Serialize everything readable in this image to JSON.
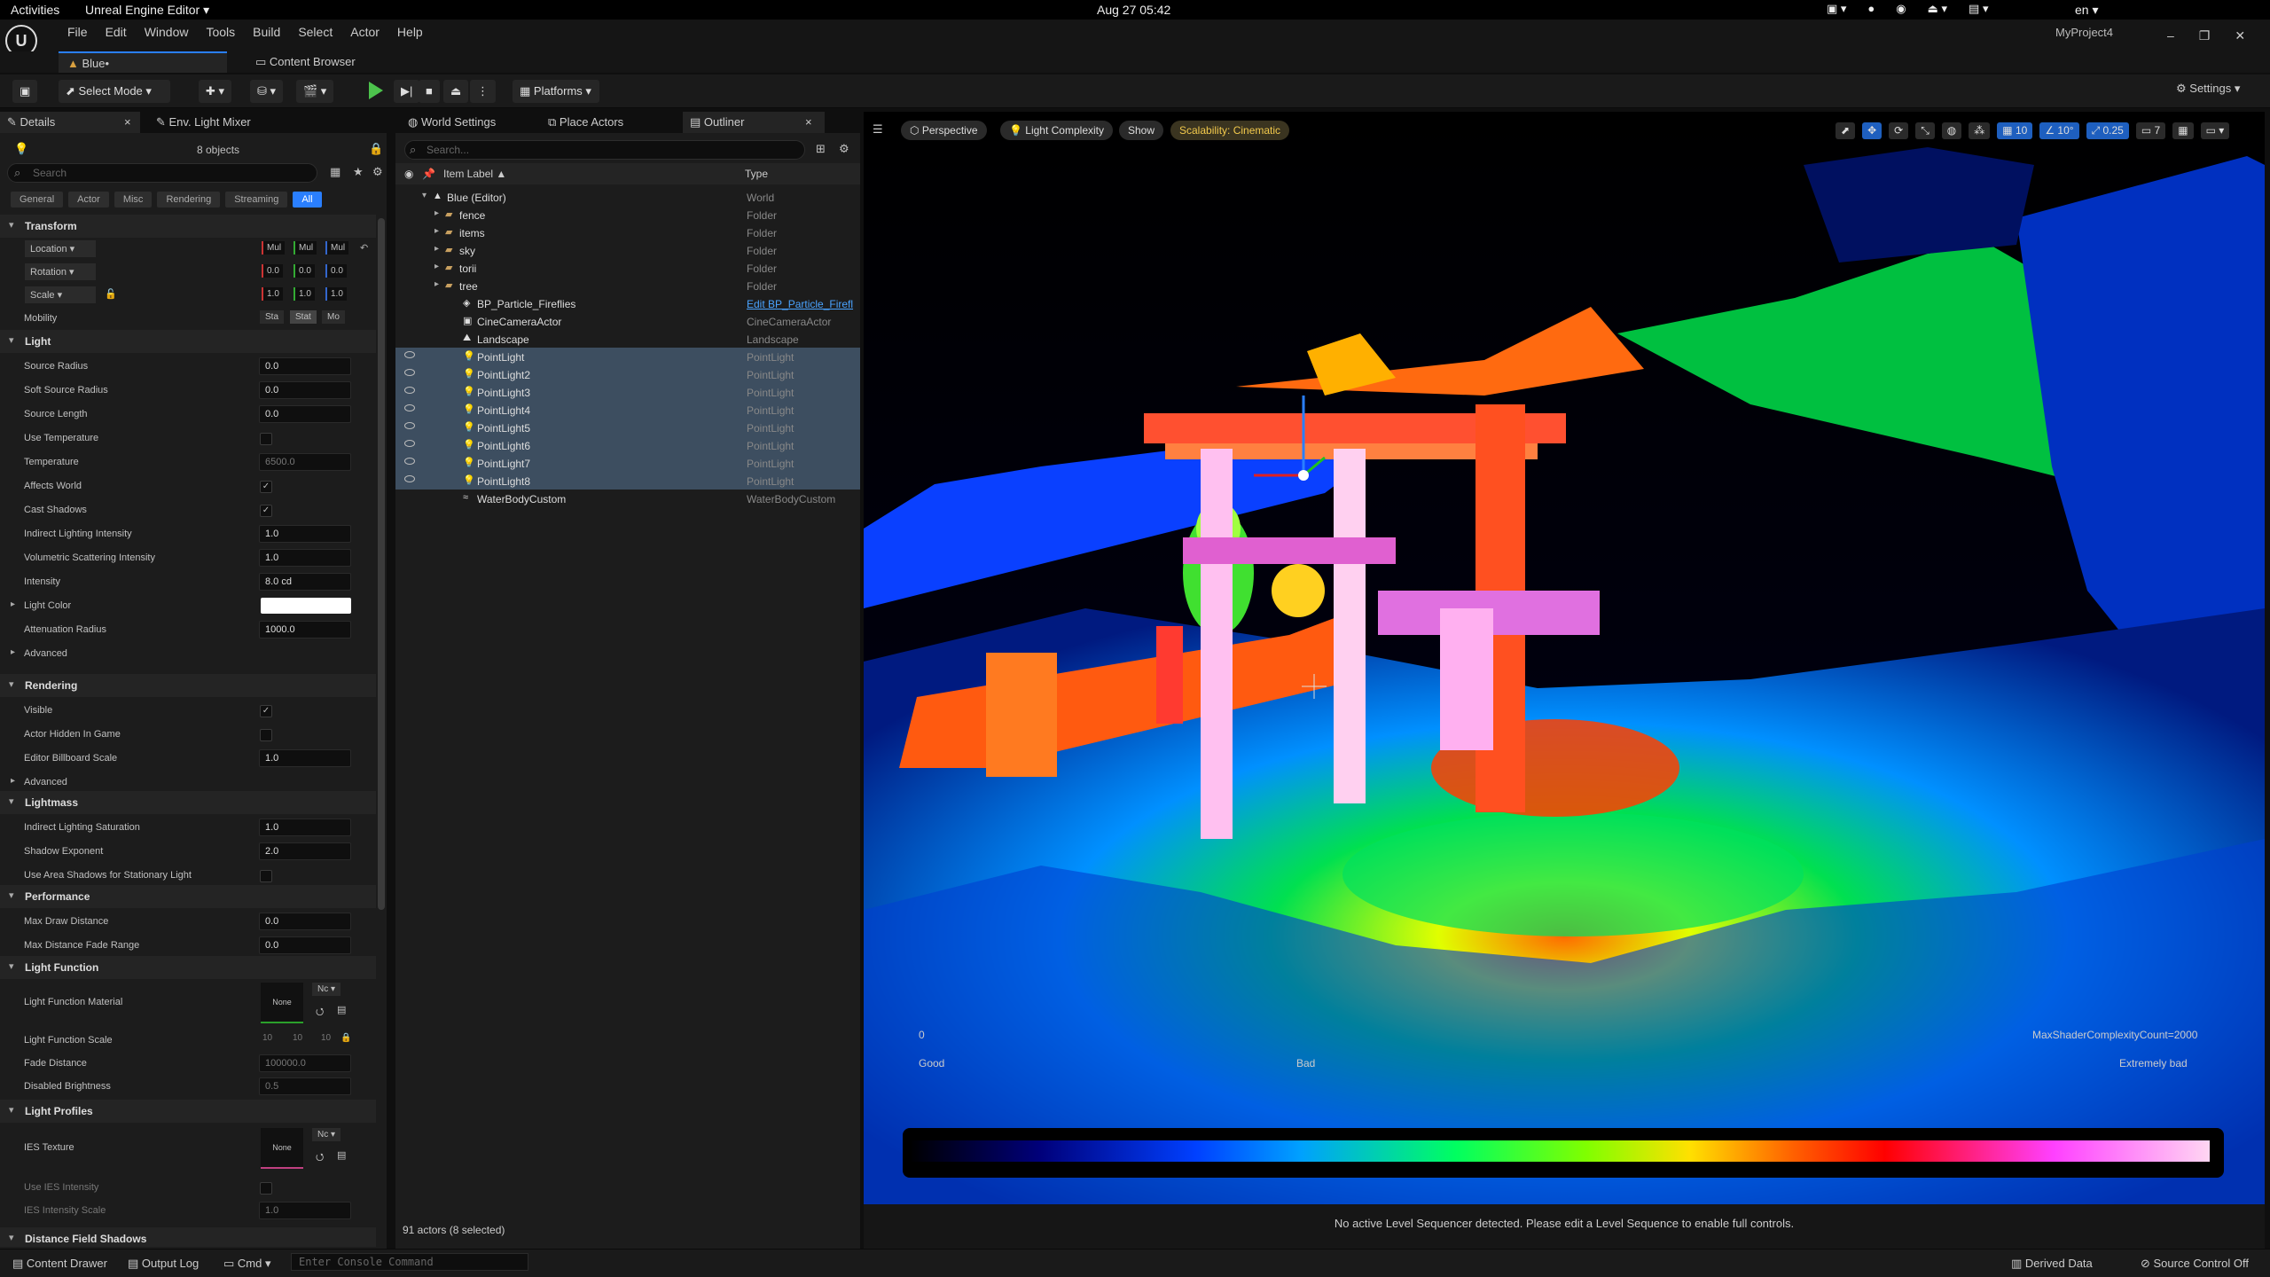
{
  "gnome": {
    "activities": "Activities",
    "app": "Unreal Engine Editor ▾",
    "clock": "Aug 27  05:42",
    "lang": "en ▾"
  },
  "menu": [
    "File",
    "Edit",
    "Window",
    "Tools",
    "Build",
    "Select",
    "Actor",
    "Help"
  ],
  "project": "MyProject4",
  "tabs": {
    "level": "Blue•",
    "content_browser": "Content Browser"
  },
  "toolbar": {
    "mode": "Select Mode",
    "platforms": "Platforms",
    "settings": "Settings"
  },
  "panel_tabs": {
    "details": "Details",
    "env_light": "Env. Light Mixer",
    "world_settings": "World Settings",
    "place_actors": "Place Actors",
    "outliner": "Outliner"
  },
  "details": {
    "count": "8 objects",
    "search_placeholder": "Search",
    "filters": [
      "General",
      "Actor",
      "Misc",
      "Rendering",
      "Streaming",
      "All"
    ],
    "sections": {
      "transform": "Transform",
      "light": "Light",
      "rendering": "Rendering",
      "lightmass": "Lightmass",
      "performance": "Performance",
      "light_function": "Light Function",
      "light_profiles": "Light Profiles",
      "dfs": "Distance Field Shadows"
    },
    "transform": {
      "location": "Location",
      "rotation": "Rotation",
      "scale": "Scale",
      "mobility": "Mobility",
      "loc_vals": [
        "Mul",
        "Mul",
        "Mul"
      ],
      "rot_vals": [
        "0.0",
        "0.0",
        "0.0"
      ],
      "scale_vals": [
        "1.0",
        "1.0",
        "1.0"
      ],
      "mobility_opts": [
        "Sta",
        "Stat",
        "Mo"
      ]
    },
    "light_props": [
      {
        "label": "Source Radius",
        "value": "0.0"
      },
      {
        "label": "Soft Source Radius",
        "value": "0.0"
      },
      {
        "label": "Source Length",
        "value": "0.0"
      },
      {
        "label": "Use Temperature",
        "value": ""
      },
      {
        "label": "Temperature",
        "value": "6500.0"
      },
      {
        "label": "Affects World",
        "value": "✓"
      },
      {
        "label": "Cast Shadows",
        "value": "✓"
      },
      {
        "label": "Indirect Lighting Intensity",
        "value": "1.0"
      },
      {
        "label": "Volumetric Scattering Intensity",
        "value": "1.0"
      },
      {
        "label": "Intensity",
        "value": "8.0 cd"
      },
      {
        "label": "Light Color",
        "value": ""
      },
      {
        "label": "Attenuation Radius",
        "value": "1000.0"
      },
      {
        "label": "Advanced",
        "value": ""
      }
    ],
    "rendering_props": [
      {
        "label": "Visible",
        "value": "✓"
      },
      {
        "label": "Actor Hidden In Game",
        "value": ""
      },
      {
        "label": "Editor Billboard Scale",
        "value": "1.0"
      },
      {
        "label": "Advanced",
        "value": ""
      }
    ],
    "lightmass_props": [
      {
        "label": "Indirect Lighting Saturation",
        "value": "1.0"
      },
      {
        "label": "Shadow Exponent",
        "value": "2.0"
      },
      {
        "label": "Use Area Shadows for Stationary Light",
        "value": ""
      }
    ],
    "performance_props": [
      {
        "label": "Max Draw Distance",
        "value": "0.0"
      },
      {
        "label": "Max Distance Fade Range",
        "value": "0.0"
      }
    ],
    "lf": {
      "material": "Light Function Material",
      "none": "None",
      "nc": "Nc",
      "scale": "Light Function Scale",
      "scale_vals": [
        "10",
        "10",
        "10"
      ],
      "fade": "Fade Distance",
      "fade_val": "100000.0",
      "disabled": "Disabled Brightness",
      "disabled_val": "0.5"
    },
    "lp": {
      "ies": "IES Texture",
      "none": "None",
      "nc": "Nc",
      "use_ies": "Use IES Intensity",
      "ies_scale": "IES Intensity Scale",
      "ies_scale_val": "1.0"
    }
  },
  "outliner": {
    "search_placeholder": "Search...",
    "col_label": "Item Label ▲",
    "col_type": "Type",
    "rows": [
      {
        "name": "Blue (Editor)",
        "type": "World",
        "indent": 0,
        "sel": false
      },
      {
        "name": "fence",
        "type": "Folder",
        "indent": 1,
        "sel": false
      },
      {
        "name": "items",
        "type": "Folder",
        "indent": 1,
        "sel": false
      },
      {
        "name": "sky",
        "type": "Folder",
        "indent": 1,
        "sel": false
      },
      {
        "name": "torii",
        "type": "Folder",
        "indent": 1,
        "sel": false
      },
      {
        "name": "tree",
        "type": "Folder",
        "indent": 1,
        "sel": false
      },
      {
        "name": "BP_Particle_Fireflies",
        "type": "Edit BP_Particle_Firefl",
        "indent": 2,
        "sel": false
      },
      {
        "name": "CineCameraActor",
        "type": "CineCameraActor",
        "indent": 2,
        "sel": false
      },
      {
        "name": "Landscape",
        "type": "Landscape",
        "indent": 2,
        "sel": false
      },
      {
        "name": "PointLight",
        "type": "PointLight",
        "indent": 2,
        "sel": true
      },
      {
        "name": "PointLight2",
        "type": "PointLight",
        "indent": 2,
        "sel": true
      },
      {
        "name": "PointLight3",
        "type": "PointLight",
        "indent": 2,
        "sel": true
      },
      {
        "name": "PointLight4",
        "type": "PointLight",
        "indent": 2,
        "sel": true
      },
      {
        "name": "PointLight5",
        "type": "PointLight",
        "indent": 2,
        "sel": true
      },
      {
        "name": "PointLight6",
        "type": "PointLight",
        "indent": 2,
        "sel": true
      },
      {
        "name": "PointLight7",
        "type": "PointLight",
        "indent": 2,
        "sel": true
      },
      {
        "name": "PointLight8",
        "type": "PointLight",
        "indent": 2,
        "sel": true
      },
      {
        "name": "WaterBodyCustom",
        "type": "WaterBodyCustom",
        "indent": 2,
        "sel": false
      }
    ],
    "footer": "91 actors (8 selected)"
  },
  "viewport": {
    "perspective": "Perspective",
    "view_mode": "Light Complexity",
    "show": "Show",
    "scalability": "Scalability: Cinematic",
    "grid": "10",
    "angle": "10°",
    "scale_snap": "0.25",
    "camera_speed": "7",
    "legend_zero": "0",
    "legend_good": "Good",
    "legend_bad": "Bad",
    "legend_max": "MaxShaderComplexityCount=2000",
    "legend_ext": "Extremely bad",
    "sequencer": "No active Level Sequencer detected. Please edit a Level Sequence to enable full controls."
  },
  "status": {
    "content_drawer": "Content Drawer",
    "output_log": "Output Log",
    "cmd": "Cmd ▾",
    "console_placeholder": "Enter Console Command",
    "derived": "Derived Data",
    "source_control": "Source Control Off"
  }
}
